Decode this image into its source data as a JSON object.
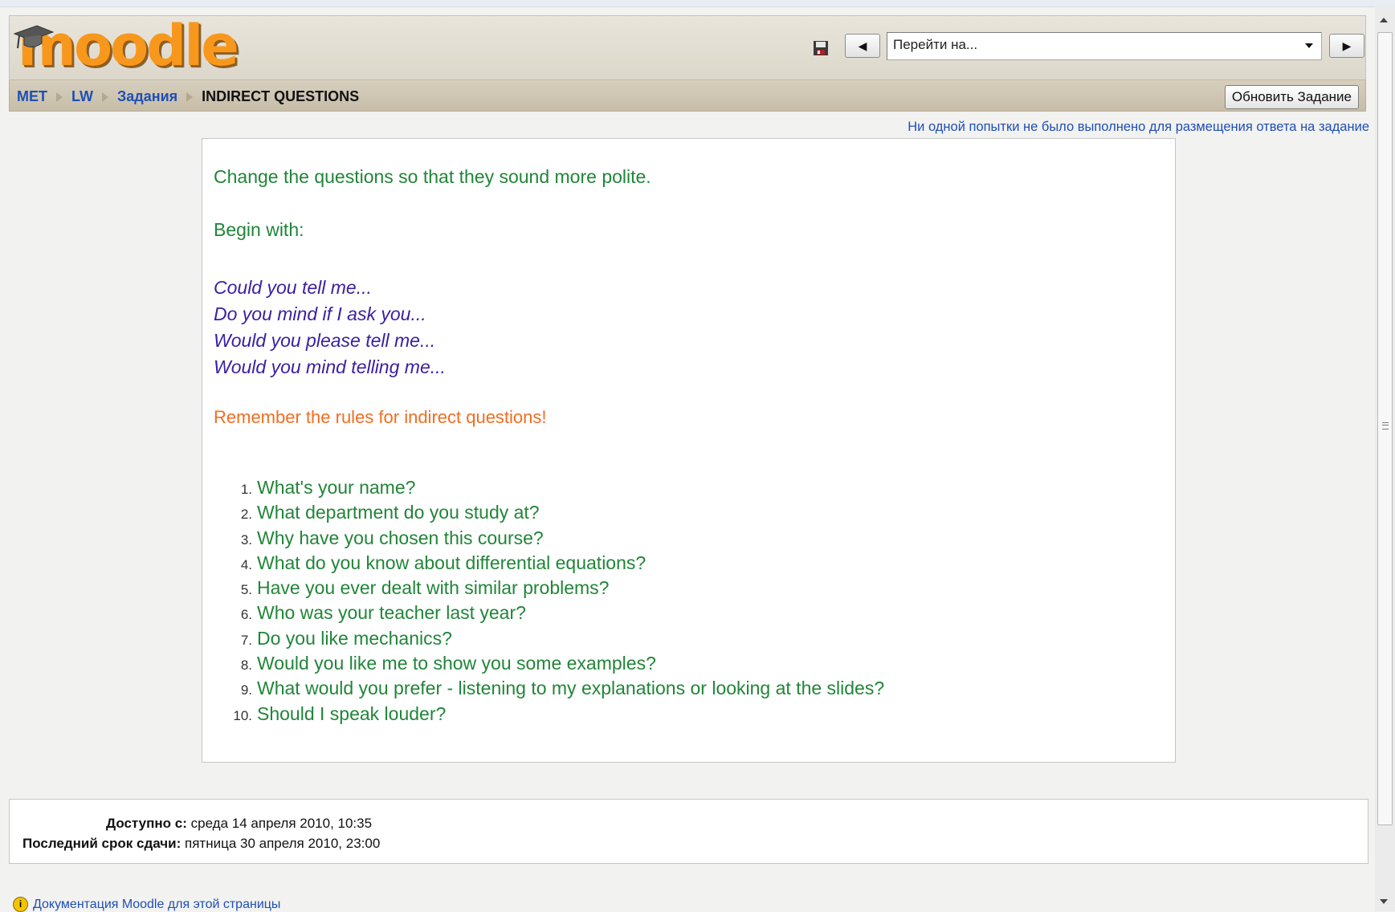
{
  "header": {
    "logo_text": "moodle",
    "jump_select": {
      "value": "Перейти на..."
    },
    "icons": {
      "save": "save-disk-icon",
      "prev": "triangle-left-icon",
      "next": "triangle-right-icon"
    }
  },
  "breadcrumb": {
    "items": [
      "MET",
      "LW",
      "Задания"
    ],
    "current": "INDIRECT QUESTIONS"
  },
  "update_button": "Обновить Задание",
  "attempts_link": "Ни одной попытки не было выполнено для размещения ответа на задание",
  "intro": {
    "instruction": "Change the questions so that they sound more polite.",
    "begin_with": "Begin with:",
    "phrases": [
      "Could you tell me...",
      "Do you mind if I ask you...",
      "Would you please tell me...",
      "Would you mind telling me..."
    ],
    "remember": "Remember the rules for indirect questions!",
    "questions": [
      {
        "num": "1.",
        "text": "What's your name?"
      },
      {
        "num": "2.",
        "text": "What department do you study at?"
      },
      {
        "num": "3.",
        "text": "Why have you chosen this course?"
      },
      {
        "num": "4.",
        "text": "What do you know about differential equations?"
      },
      {
        "num": "5.",
        "text": "Have you ever dealt with similar problems?"
      },
      {
        "num": "6.",
        "text": "Who was your teacher last year?"
      },
      {
        "num": "7.",
        "text": "Do you like mechanics?"
      },
      {
        "num": "8.",
        "text": "Would you like me to show you some examples?"
      },
      {
        "num": "9.",
        "text": "What would you prefer - listening to my explanations or looking at the slides?"
      },
      {
        "num": "10.",
        "text": "Should I speak louder?"
      }
    ]
  },
  "dates": {
    "available_label": "Доступно с:",
    "available_value": "среда 14 апреля 2010, 10:35",
    "due_label": "Последний срок сдачи:",
    "due_value": "пятница 30 апреля 2010, 23:00"
  },
  "footer": {
    "doc_link": "Документация Moodle для этой страницы",
    "icon": "info-icon"
  },
  "colors": {
    "link": "#1f4fb5",
    "green_text": "#218538",
    "purple_text": "#3a1fa0",
    "orange_text": "#f26d22",
    "logo_orange": "#f7981d"
  }
}
